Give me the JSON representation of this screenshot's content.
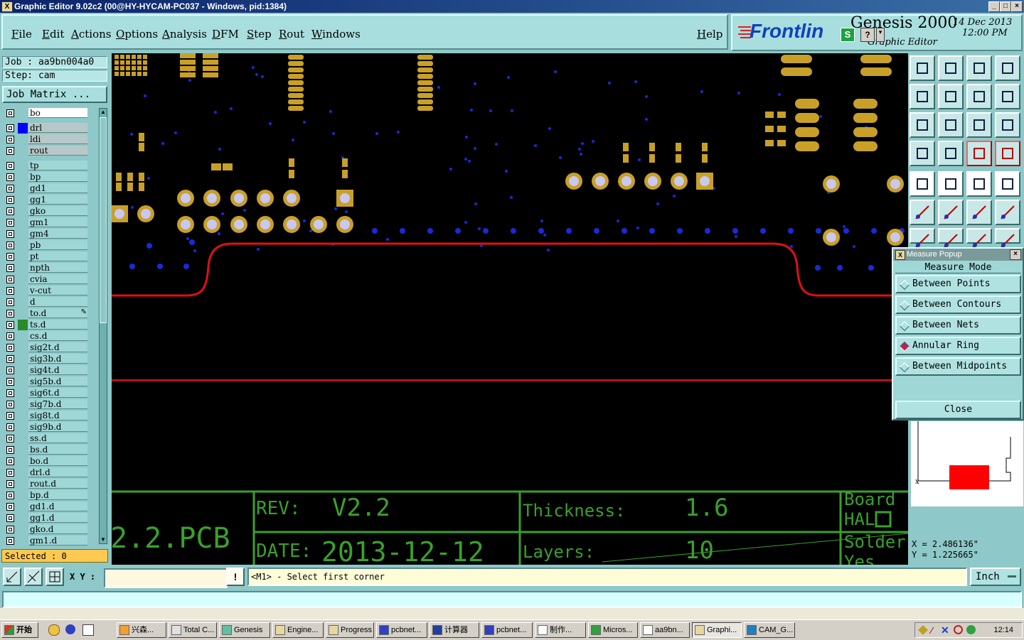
{
  "window": {
    "title": "Graphic Editor 9.02c2 (00@HY-HYCAM-PC037 - Windows, pid:1384)",
    "icon_text": "X",
    "controls": [
      "_",
      "□",
      "×"
    ]
  },
  "menu": {
    "items": [
      "File",
      "Edit",
      "Actions",
      "Options",
      "Analysis",
      "DFM",
      "Step",
      "Rout",
      "Windows"
    ],
    "help": "Help"
  },
  "brand": {
    "product": "Genesis 2000",
    "subtitle": "Graphic Editor",
    "date": "14 Dec 2013",
    "time": "12:00 PM",
    "vendor": "Frontlin",
    "s_label": "S",
    "q_label": "?"
  },
  "job": {
    "job_label": "Job : aa9bn004a0",
    "step_label": "Step: cam",
    "matrix_button": "Job Matrix ..."
  },
  "layers": {
    "top_group": [
      "bo"
    ],
    "board_group": [
      {
        "name": "drl",
        "color": "#0000ff"
      },
      {
        "name": "ldi",
        "color": ""
      },
      {
        "name": "rout",
        "color": ""
      }
    ],
    "misc_group": [
      {
        "name": "tp"
      },
      {
        "name": "bp"
      },
      {
        "name": "gd1"
      },
      {
        "name": "gg1"
      },
      {
        "name": "gko"
      },
      {
        "name": "gm1"
      },
      {
        "name": "gm4"
      },
      {
        "name": "pb"
      },
      {
        "name": "pt"
      },
      {
        "name": "npth"
      },
      {
        "name": "cvia"
      },
      {
        "name": "v-cut"
      },
      {
        "name": "d"
      },
      {
        "name": "to.d"
      },
      {
        "name": "ts.d",
        "color": "#2a8a2a"
      },
      {
        "name": "cs.d"
      },
      {
        "name": "sig2t.d"
      },
      {
        "name": "sig3b.d"
      },
      {
        "name": "sig4t.d"
      },
      {
        "name": "sig5b.d"
      },
      {
        "name": "sig6t.d"
      },
      {
        "name": "sig7b.d"
      },
      {
        "name": "sig8t.d"
      },
      {
        "name": "sig9b.d"
      },
      {
        "name": "ss.d"
      },
      {
        "name": "bs.d"
      },
      {
        "name": "bo.d"
      },
      {
        "name": "drl.d"
      },
      {
        "name": "rout.d"
      },
      {
        "name": "bp.d"
      },
      {
        "name": "gd1.d"
      },
      {
        "name": "gg1.d"
      },
      {
        "name": "gko.d"
      },
      {
        "name": "gm1.d"
      }
    ],
    "selected_label": "Selected : 0"
  },
  "title_block": {
    "pcb_name": "2.2.PCB",
    "rev_label": "REV:",
    "rev_value": "V2.2",
    "date_label": "DATE:",
    "date_value": "2013-12-12",
    "thickness_label": "Thickness:",
    "thickness_value": "1.6",
    "layers_label": "Layers:",
    "layers_value": "10",
    "board_label": "Board",
    "finish_value": "HAL",
    "solder_label": "Solder",
    "solder_value": "Yes"
  },
  "measure_popup": {
    "title": "Measure Popup",
    "mode_label": "Measure Mode",
    "options": [
      "Between Points",
      "Between Contours",
      "Between Nets",
      "Annular Ring",
      "Between Midpoints"
    ],
    "selected": "Annular Ring",
    "close_label": "Close"
  },
  "readout": {
    "x": "X = 2.486136\"",
    "y": "Y = 1.225665\""
  },
  "command": {
    "xy_label": "X Y :",
    "xy_value": "",
    "prompt": "<M1> - Select first corner",
    "units": "Inch",
    "bang": "!"
  },
  "taskbar": {
    "start": "开始",
    "tasks": [
      "兴森...",
      "Total C...",
      "Genesis",
      "Engine...",
      "Progress",
      "pcbnet...",
      "计算器",
      "pcbnet...",
      "制作...",
      "Micros...",
      "aa9bn...",
      "Graphi...",
      "CAM_G..."
    ],
    "active_task": "Graphi...",
    "clock": "12:14"
  },
  "colors": {
    "pad": "#c8a028",
    "via": "#1a2ad8",
    "outline": "#e01010",
    "text": "#3aa02a",
    "panel": "#8ec8c8"
  }
}
